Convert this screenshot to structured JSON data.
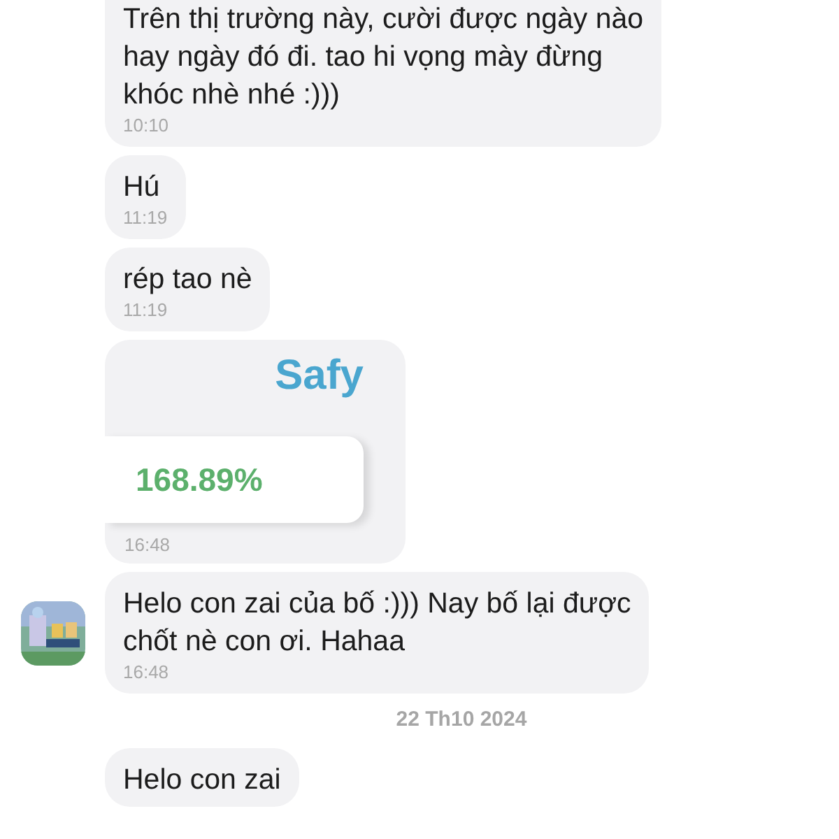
{
  "messages": [
    {
      "kind": "text",
      "lines": [
        "Trên thị trường này, cười được ngày nào",
        "hay ngày đó đi. tao hi vọng mày đừng",
        "khóc nhè nhé :)))"
      ],
      "time": "10:10",
      "avatar": false
    },
    {
      "kind": "text",
      "lines": [
        "Hú"
      ],
      "time": "11:19",
      "avatar": false
    },
    {
      "kind": "text",
      "lines": [
        "rép tao nè"
      ],
      "time": "11:19",
      "avatar": false
    },
    {
      "kind": "image",
      "logo": "Safy",
      "percent": "168.89%",
      "time": "16:48",
      "avatar": false
    },
    {
      "kind": "text",
      "lines": [
        "Helo con zai của bố :))) Nay bố lại được",
        "chốt nè con ơi. Hahaa"
      ],
      "time": "16:48",
      "avatar": true
    },
    {
      "kind": "date",
      "text": "22 Th10 2024"
    },
    {
      "kind": "text",
      "lines": [
        "Helo con zai"
      ],
      "avatar": false
    }
  ]
}
